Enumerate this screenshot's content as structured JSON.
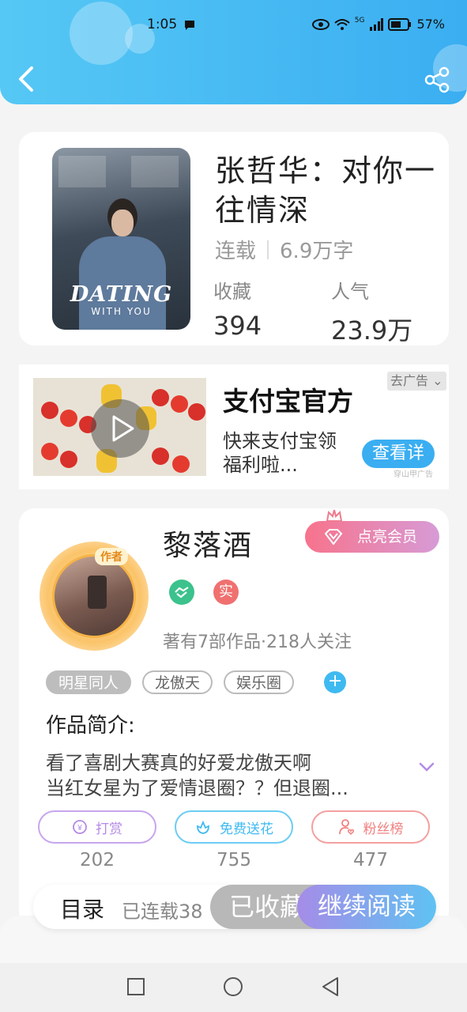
{
  "status_bar": {
    "time": "1:05",
    "battery": "57%",
    "network": "5G"
  },
  "book": {
    "title": "张哲华：对你一往情深",
    "status": "连载",
    "word_count": "6.9万字",
    "favorites_label": "收藏",
    "favorites_value": "394",
    "popularity_label": "人气",
    "popularity_value": "23.9万",
    "cover_text": "DATING",
    "cover_subtext": "WITH YOU"
  },
  "ad": {
    "title": "支付宝官方",
    "description": "快来支付宝领福利啦...",
    "close_label": "去广告",
    "cta": "查看详",
    "source": "穿山甲广告"
  },
  "author": {
    "badge": "作者",
    "name": "黎落酒",
    "vip_button": "点亮会员",
    "verified_label": "实",
    "stats": "著有7部作品·218人关注"
  },
  "tags": [
    "明星同人",
    "龙傲天",
    "娱乐圈"
  ],
  "intro": {
    "label": "作品简介:",
    "line1": "看了喜剧大赛真的好爱龙傲天啊",
    "line2": "当红女星为了爱情退圈？？但退圈..."
  },
  "actions": {
    "tip": {
      "label": "打赏",
      "count": "202"
    },
    "flower": {
      "label": "免费送花",
      "count": "755"
    },
    "fans": {
      "label": "粉丝榜",
      "count": "477"
    }
  },
  "bottom_bar": {
    "toc": "目录",
    "serial": "已连载38",
    "collected": "已收藏",
    "continue": "继续阅读"
  },
  "colors": {
    "header": "#3aaef1",
    "accent": "#3aaef1",
    "tip": "#b48ae6",
    "flower": "#3fbaf1",
    "fans": "#f08080"
  }
}
